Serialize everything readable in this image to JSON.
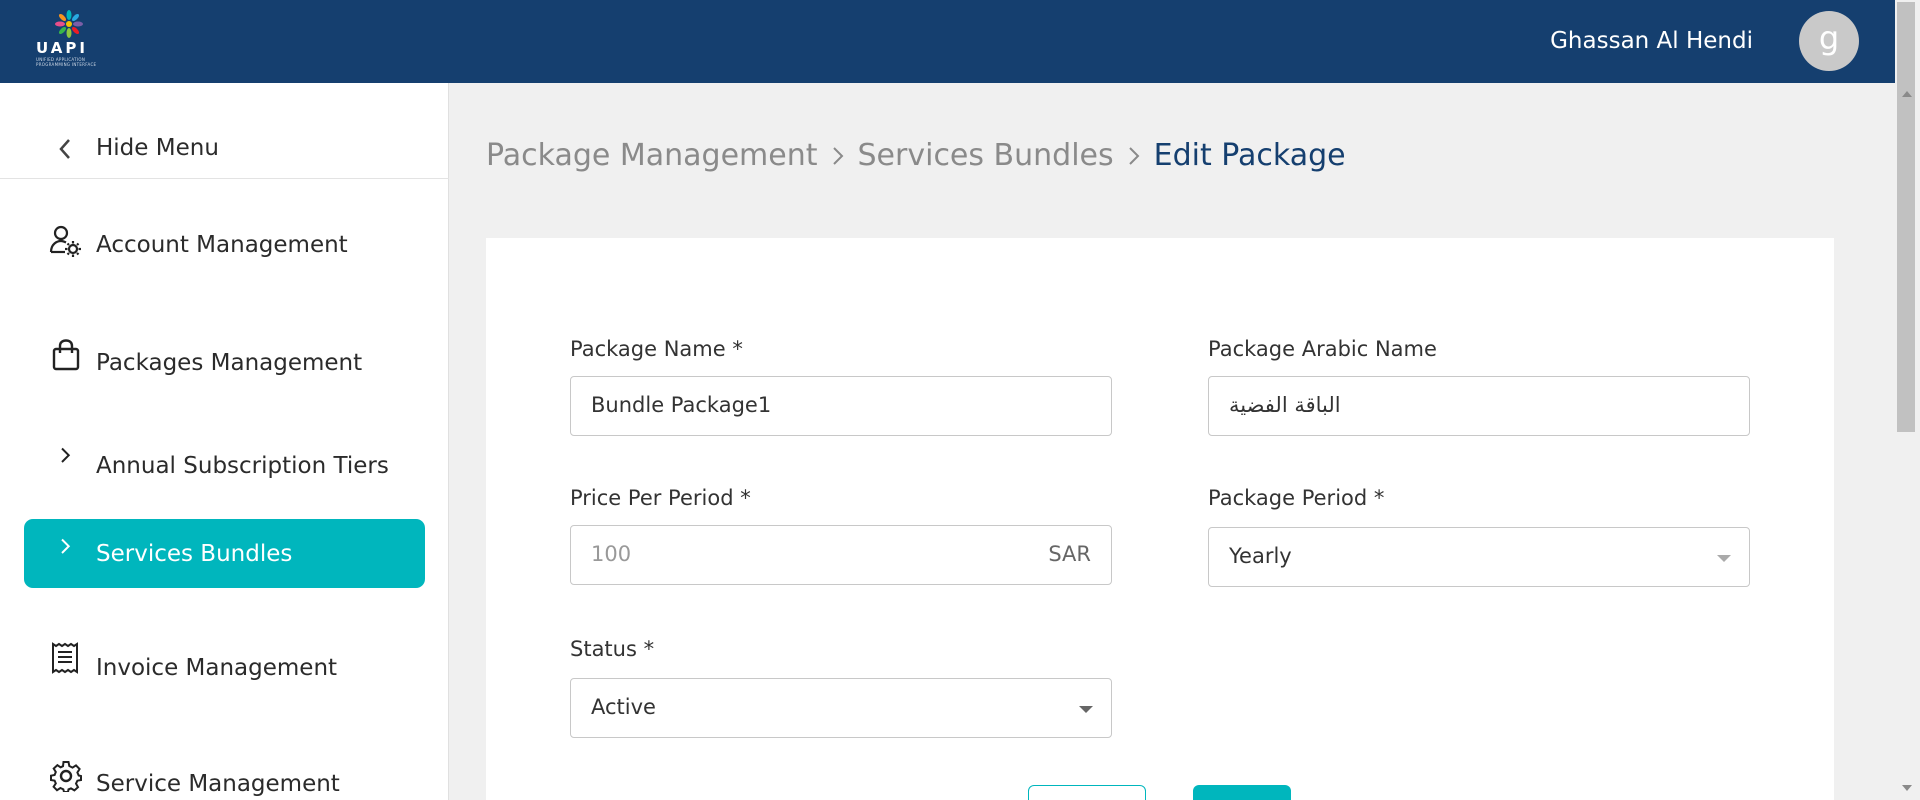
{
  "header": {
    "logo_text": "UAPI",
    "logo_tagline": "UNIFIED APPLICATION PROGRAMMING INTERFACE",
    "user_name": "Ghassan Al Hendi",
    "avatar_initial": "g",
    "bg_color": "#153f6f"
  },
  "sidebar": {
    "hide_menu_label": "Hide Menu",
    "items": [
      {
        "label": "Account Management",
        "icon": "user-gear-icon"
      },
      {
        "label": "Packages Management",
        "icon": "shopping-bag-icon"
      },
      {
        "label": "Annual Subscription Tiers",
        "icon": "chevron-right-icon"
      },
      {
        "label": "Services Bundles",
        "icon": "chevron-right-icon",
        "active": true
      },
      {
        "label": "Invoice Management",
        "icon": "receipt-icon"
      },
      {
        "label": "Service Management",
        "icon": "gear-icon"
      }
    ],
    "active_color": "#00b6bd"
  },
  "breadcrumb": {
    "items": [
      "Package Management",
      "Services Bundles"
    ],
    "current": "Edit Package"
  },
  "form": {
    "package_name": {
      "label": "Package Name *",
      "value": "Bundle Package1"
    },
    "package_arabic_name": {
      "label": "Package Arabic Name",
      "value": "الباقة الفضية"
    },
    "price_per_period": {
      "label": "Price Per Period *",
      "placeholder": "100",
      "suffix": "SAR"
    },
    "package_period": {
      "label": "Package Period *",
      "value": "Yearly"
    },
    "status": {
      "label": "Status *",
      "value": "Active"
    }
  }
}
